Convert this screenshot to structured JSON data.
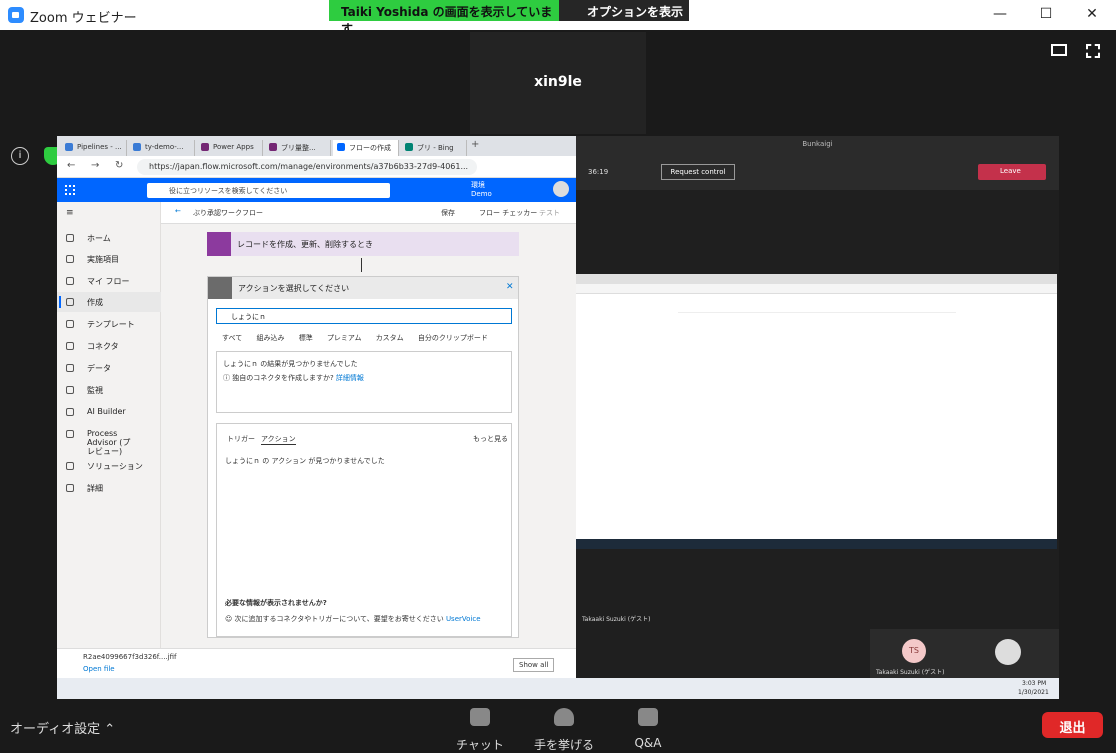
{
  "window": {
    "title": "Zoom ウェビナー",
    "minimize": "—",
    "maximize": "☐",
    "close": "✕"
  },
  "share_banner": {
    "text": "Taiki  Yoshida  の画面を表示しています",
    "options": "オプションを表示"
  },
  "speaker": {
    "name": "xin9le"
  },
  "browser": {
    "tabs": [
      "Pipelines - ...",
      "ty-demo-...",
      "Power Apps",
      "ブリ量整...",
      "フローの作成",
      "ブリ - Bing"
    ],
    "url": "https://japan.flow.microsoft.com/manage/environments/a37b6b33-27d9-4061...",
    "search_placeholder": "役に立つリソースを検索してください",
    "env_label": "環境",
    "env_name": "Demo",
    "sidebar": [
      "ホーム",
      "実施項目",
      "マイ フロー",
      "作成",
      "テンプレート",
      "コネクタ",
      "データ",
      "監視",
      "AI Builder",
      "Process Advisor (プレビュー)",
      "ソリューション",
      "詳細"
    ],
    "back_label": "ぶり承認ワークフロー",
    "save_label": "保存",
    "checker_label": "フロー チェッカー",
    "test_label": "テスト",
    "trigger_label": "レコードを作成、更新、削除するとき",
    "action_title": "アクションを選択してください",
    "action_search_value": "しょうにｎ",
    "filter_tabs": [
      "すべて",
      "組み込み",
      "標準",
      "プレミアム",
      "カスタム",
      "自分のクリップボード"
    ],
    "no_results": "しょうにｎ の結果が見つかりませんでした",
    "connector_question": "独自のコネクタを作成しますか?",
    "details_link": "詳細情報",
    "lower_tabs": [
      "トリガー",
      "アクション"
    ],
    "more": "もっと見る",
    "no_actions": "しょうにｎ の アクション が見つかりませんでした",
    "missing_info": "必要な情報が表示されませんか?",
    "feedback": "次に追加するコネクタやトリガーについて、要望をお寄せください",
    "uservoice": "UserVoice",
    "download_file": "R2ae4099667f3d326f....jfif",
    "open_file": "Open file",
    "show_all": "Show all"
  },
  "teams": {
    "title": "Bunkaigi",
    "time": "36:19",
    "request_control": "Request control",
    "leave": "Leave",
    "participant_name": "Takaaki Suzuki (ゲスト)",
    "participant_initials": "TS",
    "tile_name": "Takaaki Suzuki (ゲスト)",
    "clock_time": "3:03 PM",
    "clock_date": "1/30/2021"
  },
  "zoombar": {
    "audio": "オーディオ設定",
    "chat": "チャット",
    "raise_hand": "手を挙げる",
    "qa": "Q&A",
    "exit": "退出"
  }
}
